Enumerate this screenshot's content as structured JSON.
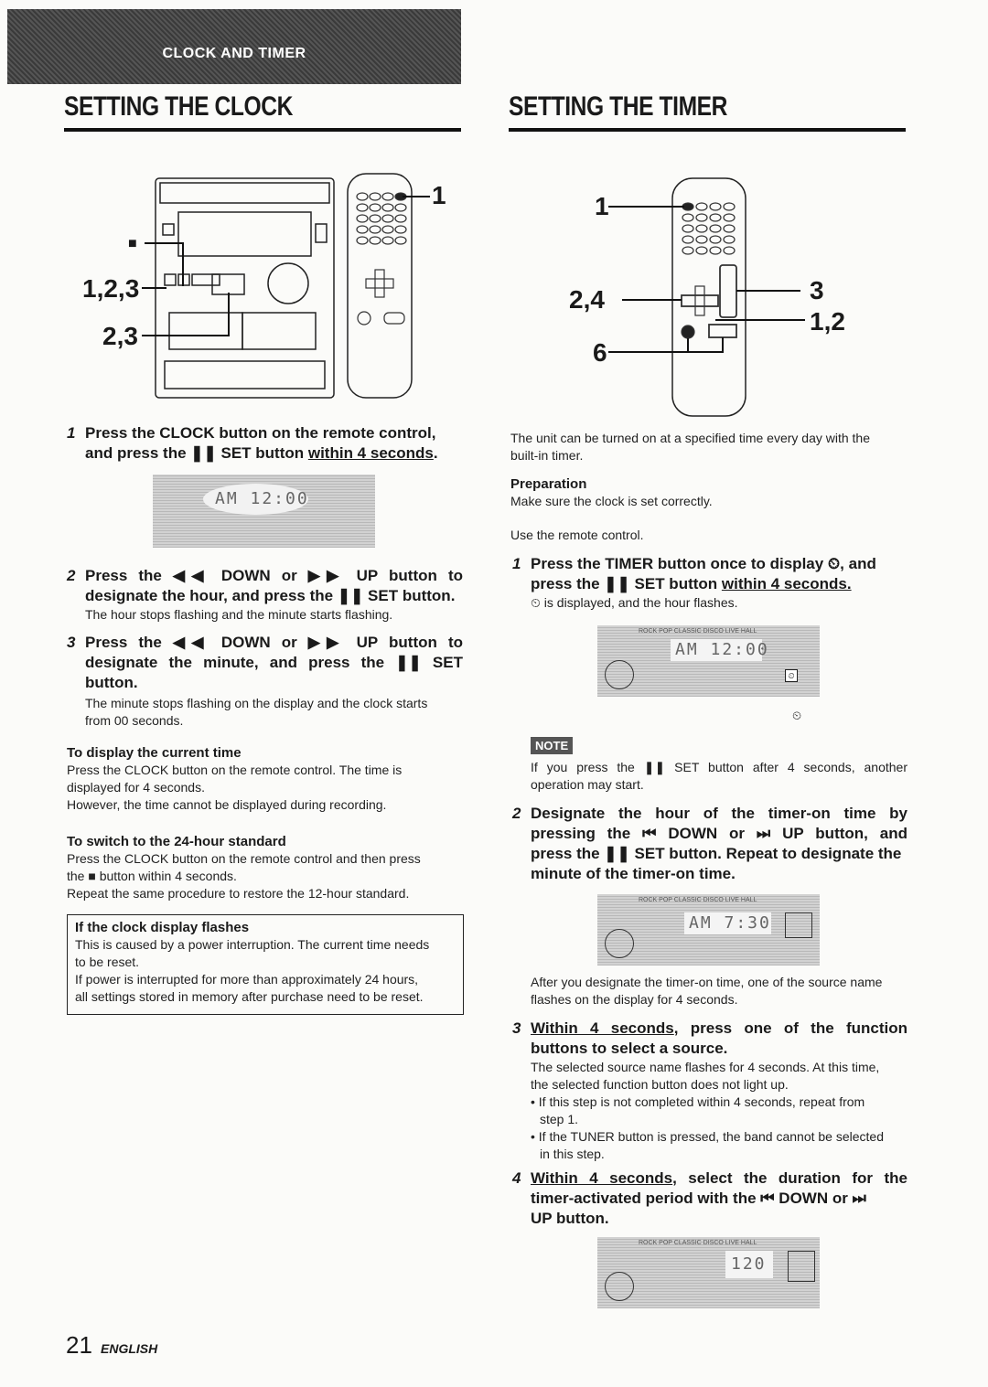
{
  "header": {
    "banner": "CLOCK AND TIMER",
    "left_title": "SETTING THE CLOCK",
    "right_title": "SETTING THE TIMER"
  },
  "clock": {
    "diagram": {
      "callouts": [
        "1",
        "■",
        "1,2,3",
        "2,3"
      ]
    },
    "step1": {
      "num": "1",
      "text_a": "Press the CLOCK button on the remote control,",
      "text_b_pre": "and press the ",
      "pause_icon": "❚❚",
      "text_b_mid": " SET button ",
      "text_b_ul": "within 4 seconds",
      "text_b_end": "."
    },
    "lcd1": "AM 12:00",
    "step2": {
      "num": "2",
      "line1": "Press the ◀◀ DOWN or ▶▶ UP button to",
      "line2": "designate the hour, and press the ❚❚ SET button.",
      "desc": "The hour stops flashing and the minute starts flashing."
    },
    "step3": {
      "num": "3",
      "line1": "Press the ◀◀ DOWN or ▶▶ UP button to",
      "line2": "designate the minute, and press the ❚❚ SET",
      "line3": "button.",
      "desc1": "The minute stops flashing on the display and the clock starts",
      "desc2": "from 00 seconds."
    },
    "display_current": {
      "title": "To display the current time",
      "l1": "Press the CLOCK button on the remote control.  The time is",
      "l2": "displayed for 4 seconds.",
      "l3": "However, the time cannot be displayed during recording."
    },
    "switch_24": {
      "title": "To switch to the 24-hour standard",
      "l1": "Press the CLOCK button on the remote control and then press",
      "l2": "the ■ button within 4 seconds.",
      "l3": "Repeat the same procedure to restore the 12-hour standard."
    },
    "flash_box": {
      "title": "If the clock display flashes",
      "l1": "This is caused by a power interruption. The current time needs",
      "l2": "to be reset.",
      "l3": "If power is interrupted for more than approximately 24 hours,",
      "l4": "all settings stored in memory after purchase need to be reset."
    }
  },
  "timer": {
    "diagram": {
      "callouts": [
        "1",
        "2,4",
        "3",
        "1,2",
        "6"
      ]
    },
    "intro1": "The unit can be turned on at a specified time every day with the",
    "intro2": "built-in timer.",
    "prep_title": "Preparation",
    "prep_text": "Make sure the clock is set correctly.",
    "use_remote": "Use the remote control.",
    "step1": {
      "num": "1",
      "line1": "Press the TIMER button once to display ⏲, and",
      "line2_pre": "press the ❚❚ SET button ",
      "line2_ul": "within 4 seconds.",
      "desc": "⏲ is displayed, and the hour flashes."
    },
    "lcd_modes": "ROCK  POP  CLASSIC  DISCO  LIVE  HALL",
    "lcd1": "AM 12:00",
    "note_label": "NOTE",
    "note1": "If you press the ❚❚ SET button after 4 seconds, another",
    "note2": "operation may start.",
    "step2": {
      "num": "2",
      "line1": "Designate the hour of the timer-on time by",
      "line2": "pressing the ⏮ DOWN or ⏭ UP button, and",
      "line3": "press the ❚❚ SET button. Repeat to designate the",
      "line4": "minute of the timer-on time."
    },
    "lcd2": "AM  7:30",
    "after1": "After you designate the timer-on time, one of the source name",
    "after2": "flashes on the display for 4 seconds.",
    "step3": {
      "num": "3",
      "ul": "Within 4 seconds",
      "line1_rest": ", press one of the function",
      "line2": "buttons to select a source.",
      "desc1": "The selected source name flashes for 4 seconds.  At this time,",
      "desc2": "the selected function button does not light up.",
      "bullet1a": "• If this step is not completed within 4 seconds, repeat from",
      "bullet1b": "step 1.",
      "bullet2a": "• If the TUNER button is pressed, the band cannot be selected",
      "bullet2b": "in this step."
    },
    "step4": {
      "num": "4",
      "ul": "Within 4 seconds",
      "line1_rest": ", select the duration for the",
      "line2": "timer-activated period with the ⏮ DOWN or ⏭",
      "line3": "UP button."
    },
    "lcd3": "120"
  },
  "footer": {
    "page_number": "21",
    "language": "ENGLISH"
  }
}
